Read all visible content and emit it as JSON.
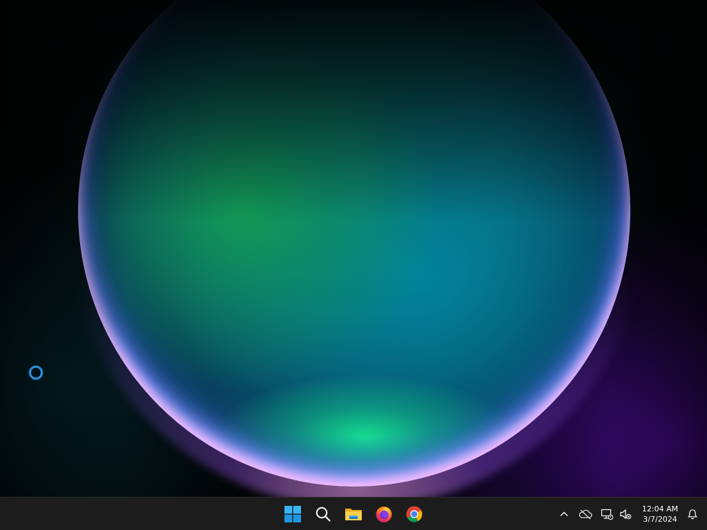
{
  "desktop": {
    "wallpaper": "windows-11-bloom-wallpaper"
  },
  "cursor": {
    "state": "busy"
  },
  "taskbar": {
    "apps": [
      {
        "name": "Start",
        "icon": "windows-start-icon"
      },
      {
        "name": "Search",
        "icon": "search-icon"
      },
      {
        "name": "File Explorer",
        "icon": "file-explorer-icon"
      },
      {
        "name": "Firefox",
        "icon": "firefox-icon"
      },
      {
        "name": "Google Chrome",
        "icon": "chrome-icon"
      }
    ],
    "tray": {
      "icons": [
        "chevron-up-icon",
        "onedrive-offline-icon",
        "network-disconnected-icon",
        "speaker-muted-icon"
      ],
      "time": "12:04 AM",
      "date": "3/7/2024",
      "notification_icon": "bell-icon"
    },
    "colors": {
      "background": "#1c1c1c",
      "start_accent": "#3ab4f2",
      "text": "#ffffff"
    }
  }
}
